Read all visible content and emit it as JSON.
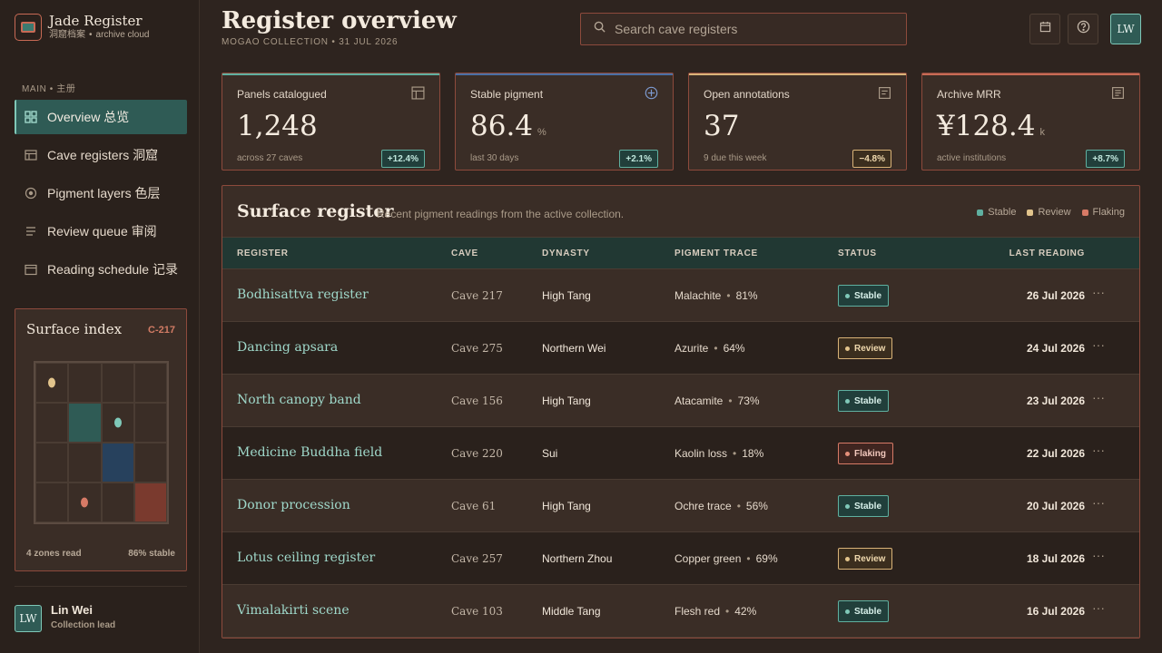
{
  "brand": {
    "title": "Jade Register",
    "sub_cn": "洞窟档案",
    "sub": "archive cloud"
  },
  "nav": {
    "section": "MAIN • 主册",
    "items": [
      {
        "label": "Overview 总览",
        "icon": "grid-icon"
      },
      {
        "label": "Cave registers 洞窟",
        "icon": "table-icon"
      },
      {
        "label": "Pigment layers 色层",
        "icon": "target-icon"
      },
      {
        "label": "Review queue 审阅",
        "icon": "list-icon"
      },
      {
        "label": "Reading schedule 记录",
        "icon": "calendar-icon"
      }
    ]
  },
  "surface_index": {
    "title": "Surface index",
    "code": "C-217",
    "zones_read": "4 zones read",
    "stable": "86% stable"
  },
  "user": {
    "initials": "LW",
    "name": "Lin Wei",
    "role": "Collection lead"
  },
  "header": {
    "title": "Register overview",
    "subtitle": "MOGAO COLLECTION • 31 JUL 2026",
    "search_placeholder": "Search cave registers",
    "avatar": "LW"
  },
  "kpis": [
    {
      "label": "Panels catalogued",
      "value": "1,248",
      "unit": "",
      "foot": "across 27 caves",
      "delta": "+12.4%",
      "trend": "up",
      "accent": "#5fb0a0",
      "icon": "table-icon"
    },
    {
      "label": "Stable pigment",
      "value": "86.4",
      "unit": "%",
      "foot": "last 30 days",
      "delta": "+2.1%",
      "trend": "up",
      "accent": "#4a6fa5",
      "icon": "target-icon"
    },
    {
      "label": "Open annotations",
      "value": "37",
      "unit": "",
      "foot": "9 due this week",
      "delta": "−4.8%",
      "trend": "down",
      "accent": "#d9b378",
      "icon": "note-icon"
    },
    {
      "label": "Archive MRR",
      "value": "¥128.4",
      "unit": "k",
      "foot": "active institutions",
      "delta": "+8.7%",
      "trend": "up",
      "accent": "#c86a55",
      "icon": "doc-icon"
    }
  ],
  "panel": {
    "title": "Surface register",
    "description": "Recent pigment readings from the active collection.",
    "legend": [
      {
        "label": "Stable",
        "color": "#5fb0a0"
      },
      {
        "label": "Review",
        "color": "#e2c48c"
      },
      {
        "label": "Flaking",
        "color": "#d77a66"
      }
    ],
    "columns": [
      "REGISTER",
      "CAVE",
      "DYNASTY",
      "PIGMENT TRACE",
      "STATUS",
      "LAST READING"
    ],
    "rows": [
      {
        "register": "Bodhisattva register",
        "cave": "Cave 217",
        "dynasty": "High Tang",
        "pigment": "Malachite",
        "pct": "81%",
        "status": "Stable",
        "date": "26 Jul 2026"
      },
      {
        "register": "Dancing apsara",
        "cave": "Cave 275",
        "dynasty": "Northern Wei",
        "pigment": "Azurite",
        "pct": "64%",
        "status": "Review",
        "date": "24 Jul 2026"
      },
      {
        "register": "North canopy band",
        "cave": "Cave 156",
        "dynasty": "High Tang",
        "pigment": "Atacamite",
        "pct": "73%",
        "status": "Stable",
        "date": "23 Jul 2026"
      },
      {
        "register": "Medicine Buddha field",
        "cave": "Cave 220",
        "dynasty": "Sui",
        "pigment": "Kaolin loss",
        "pct": "18%",
        "status": "Flaking",
        "date": "22 Jul 2026"
      },
      {
        "register": "Donor procession",
        "cave": "Cave 61",
        "dynasty": "High Tang",
        "pigment": "Ochre trace",
        "pct": "56%",
        "status": "Stable",
        "date": "20 Jul 2026"
      },
      {
        "register": "Lotus ceiling register",
        "cave": "Cave 257",
        "dynasty": "Northern Zhou",
        "pigment": "Copper green",
        "pct": "69%",
        "status": "Review",
        "date": "18 Jul 2026"
      },
      {
        "register": "Vimalakirti scene",
        "cave": "Cave 103",
        "dynasty": "Middle Tang",
        "pigment": "Flesh red",
        "pct": "42%",
        "status": "Stable",
        "date": "16 Jul 2026"
      }
    ]
  }
}
